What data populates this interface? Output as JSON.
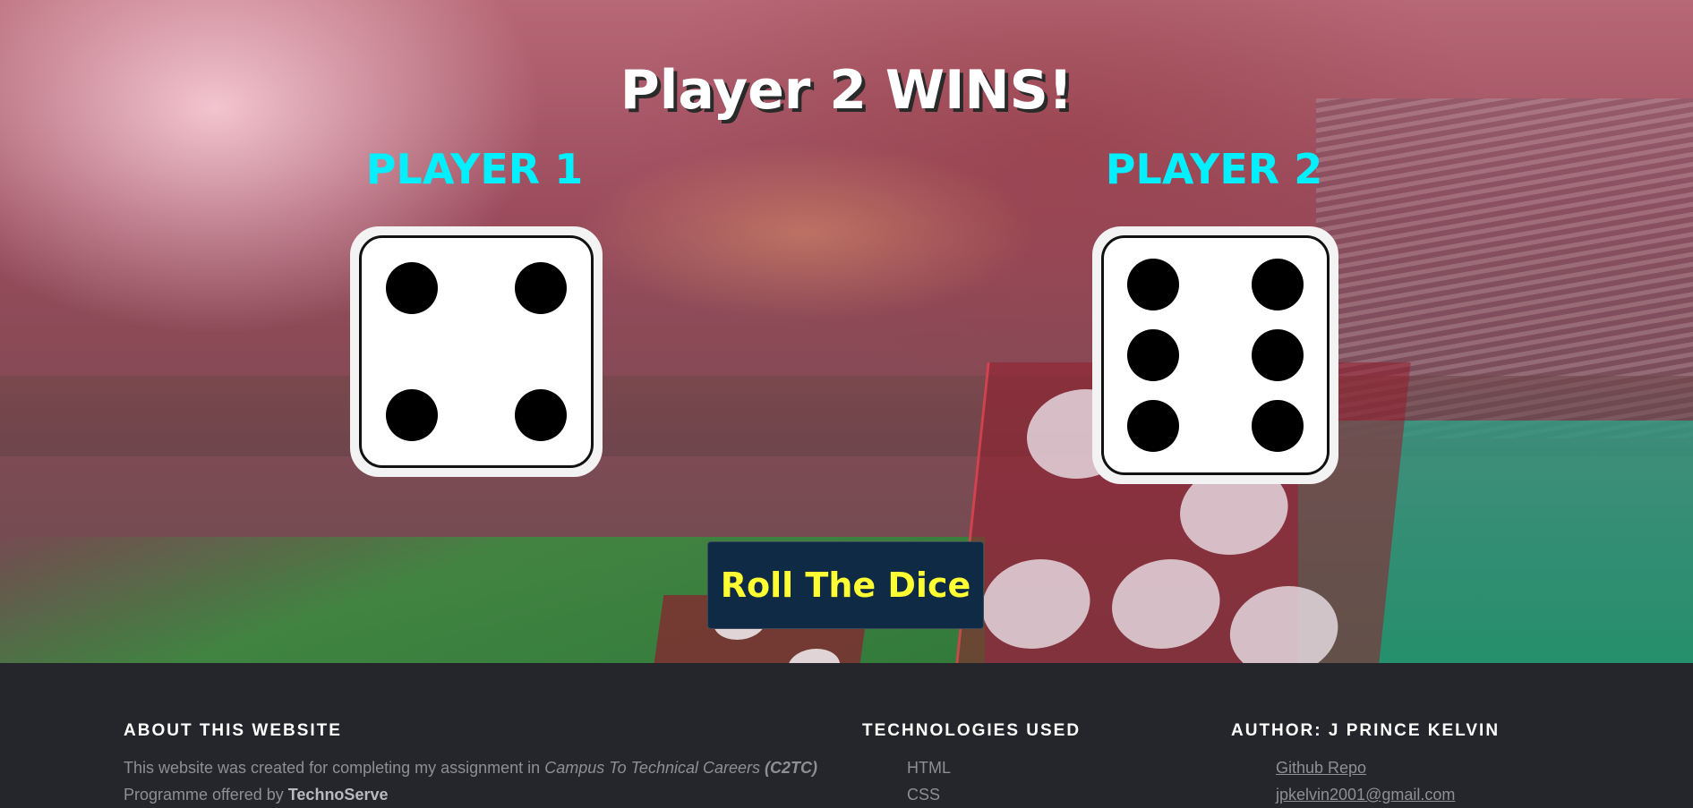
{
  "game": {
    "result_title": "Player 2 WINS!",
    "players": [
      {
        "label": "PLAYER 1",
        "die_value": 4
      },
      {
        "label": "PLAYER 2",
        "die_value": 6
      }
    ],
    "roll_button_label": "Roll The Dice"
  },
  "footer": {
    "about": {
      "heading": "ABOUT THIS WEBSITE",
      "text_prefix": "This website was created for completing my assignment in ",
      "program_name": "Campus To Technical Careers",
      "program_abbr": "(C2TC)",
      "text_suffix": "Programme offered by ",
      "org": "TechnoServe"
    },
    "technologies": {
      "heading": "TECHNOLOGIES USED",
      "items": [
        "HTML",
        "CSS"
      ]
    },
    "author": {
      "heading": "AUTHOR: J PRINCE KELVIN",
      "links": [
        "Github Repo",
        "jpkelvin2001@gmail.com"
      ]
    }
  },
  "colors": {
    "player_label": "#00f0ff",
    "button_bg": "#0f2a44",
    "button_text": "#ffff33",
    "footer_bg": "#25262b"
  }
}
